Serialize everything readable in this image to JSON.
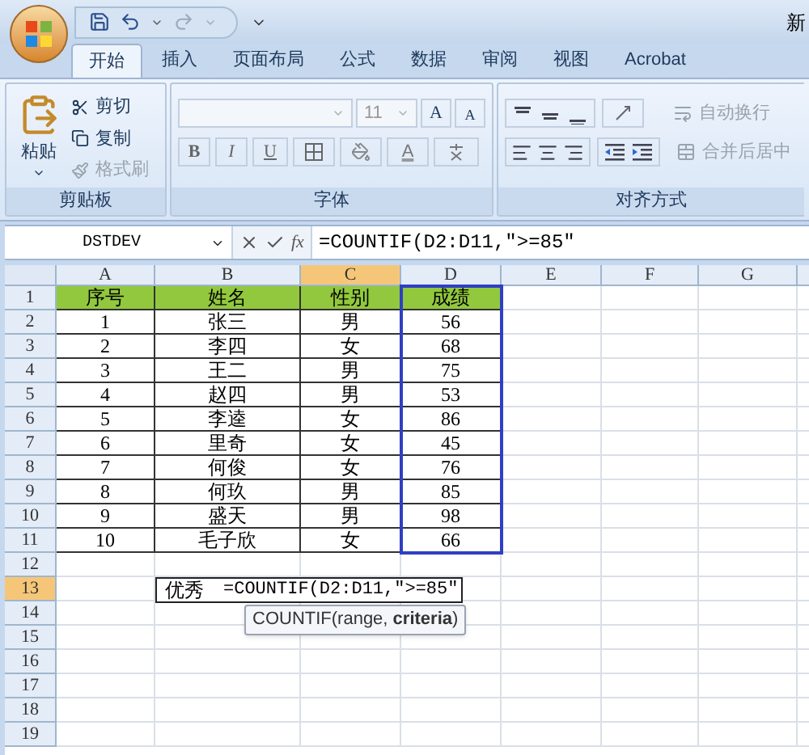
{
  "window": {
    "title_fragment": "新"
  },
  "tabs": [
    {
      "label": "开始",
      "selected": true
    },
    {
      "label": "插入",
      "selected": false
    },
    {
      "label": "页面布局",
      "selected": false
    },
    {
      "label": "公式",
      "selected": false
    },
    {
      "label": "数据",
      "selected": false
    },
    {
      "label": "审阅",
      "selected": false
    },
    {
      "label": "视图",
      "selected": false
    },
    {
      "label": "Acrobat",
      "selected": false
    }
  ],
  "clipboard": {
    "label": "剪贴板",
    "paste": "粘贴",
    "cut": {
      "label": "剪切",
      "disabled": false
    },
    "copy": {
      "label": "复制",
      "disabled": false
    },
    "format_painter": {
      "label": "格式刷",
      "disabled": true
    }
  },
  "font": {
    "label": "字体",
    "size": "11",
    "grow": "A",
    "shrink": "A",
    "bold": "B",
    "italic": "I",
    "underline": "U",
    "font_color": "A"
  },
  "alignment": {
    "label": "对齐方式",
    "wrap_text": {
      "label": "自动换行",
      "disabled": true
    },
    "merge_center": {
      "label": "合并后居中",
      "disabled": true
    }
  },
  "name_box": "DSTDEV",
  "fx": "fx",
  "formula": "=COUNTIF(D2:D11,″>=85″",
  "columns": [
    {
      "label": "A",
      "selected": false
    },
    {
      "label": "B",
      "selected": false
    },
    {
      "label": "C",
      "selected": true
    },
    {
      "label": "D",
      "selected": false
    },
    {
      "label": "E",
      "selected": false
    },
    {
      "label": "F",
      "selected": false
    },
    {
      "label": "G",
      "selected": false
    }
  ],
  "rows": [
    {
      "number": "1",
      "selected": false,
      "kind": "header",
      "cells": [
        "序号",
        "姓名",
        "性别",
        "成绩"
      ]
    },
    {
      "number": "2",
      "selected": false,
      "kind": "data",
      "cells": [
        "1",
        "张三",
        "男",
        "56"
      ]
    },
    {
      "number": "3",
      "selected": false,
      "kind": "data",
      "cells": [
        "2",
        "李四",
        "女",
        "68"
      ]
    },
    {
      "number": "4",
      "selected": false,
      "kind": "data",
      "cells": [
        "3",
        "王二",
        "男",
        "75"
      ]
    },
    {
      "number": "5",
      "selected": false,
      "kind": "data",
      "cells": [
        "4",
        "赵四",
        "男",
        "53"
      ]
    },
    {
      "number": "6",
      "selected": false,
      "kind": "data",
      "cells": [
        "5",
        "李逵",
        "女",
        "86"
      ]
    },
    {
      "number": "7",
      "selected": false,
      "kind": "data",
      "cells": [
        "6",
        "里奇",
        "女",
        "45"
      ]
    },
    {
      "number": "8",
      "selected": false,
      "kind": "data",
      "cells": [
        "7",
        "何俊",
        "女",
        "76"
      ]
    },
    {
      "number": "9",
      "selected": false,
      "kind": "data",
      "cells": [
        "8",
        "何玖",
        "男",
        "85"
      ]
    },
    {
      "number": "10",
      "selected": false,
      "kind": "data",
      "cells": [
        "9",
        "盛天",
        "男",
        "98"
      ]
    },
    {
      "number": "11",
      "selected": false,
      "kind": "data",
      "cells": [
        "10",
        "毛子欣",
        "女",
        "66"
      ]
    },
    {
      "number": "12",
      "selected": false,
      "kind": "empty"
    },
    {
      "number": "13",
      "selected": true,
      "kind": "edit",
      "label": "优秀",
      "input": "=COUNTIF(D2:D11,″>=85″"
    },
    {
      "number": "14",
      "selected": false,
      "kind": "empty"
    },
    {
      "number": "15",
      "selected": false,
      "kind": "empty"
    },
    {
      "number": "16",
      "selected": false,
      "kind": "empty"
    },
    {
      "number": "17",
      "selected": false,
      "kind": "empty"
    },
    {
      "number": "18",
      "selected": false,
      "kind": "empty"
    },
    {
      "number": "19",
      "selected": false,
      "kind": "empty"
    }
  ],
  "tooltip": "COUNTIF(range, **criteria**)"
}
